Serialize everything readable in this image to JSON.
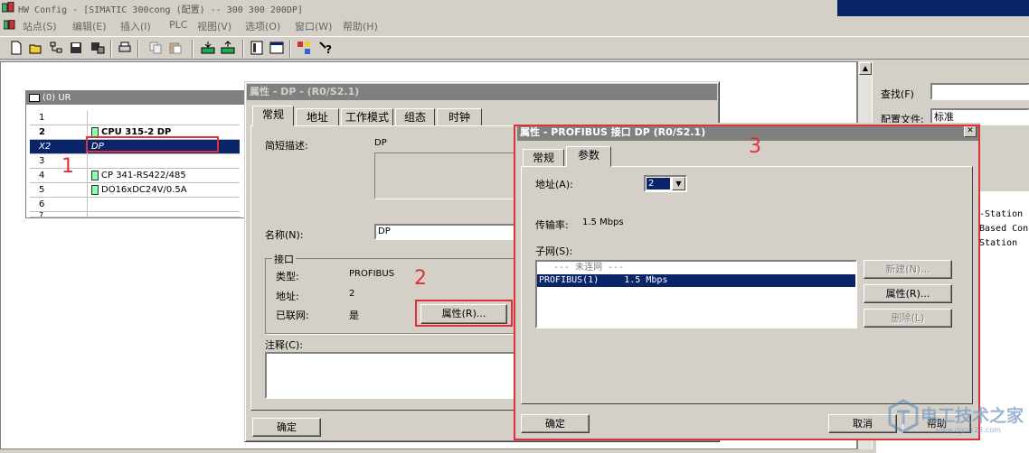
{
  "window": {
    "title": "HW Config - [SIMATIC 300cong (配置) -- 300 300 200DP]"
  },
  "menu": [
    "站点(S)",
    "编辑(E)",
    "插入(I)",
    "PLC",
    "视图(V)",
    "选项(O)",
    "窗口(W)",
    "帮助(H)"
  ],
  "toolbar_icons": [
    "new-icon",
    "open-icon",
    "network-icon",
    "save-icon",
    "save-compile-icon",
    "print-icon",
    "copy-icon",
    "paste-icon",
    "download-icon",
    "upload-icon",
    "hardware-catalog-icon",
    "window-icon",
    "network-view-icon",
    "help-icon"
  ],
  "rack": {
    "title": "(0) UR",
    "rows": [
      {
        "slot": "1",
        "module": ""
      },
      {
        "slot": "2",
        "module": "CPU 315-2 DP"
      },
      {
        "slot": "X2",
        "module": "DP"
      },
      {
        "slot": "3",
        "module": ""
      },
      {
        "slot": "4",
        "module": "CP 341-RS422/485"
      },
      {
        "slot": "5",
        "module": "DO16xDC24V/0.5A"
      },
      {
        "slot": "6",
        "module": ""
      },
      {
        "slot": "7",
        "module": ""
      }
    ]
  },
  "right_panel": {
    "search_label": "查找(F)",
    "search_value": "",
    "profile_label": "配置文件:",
    "profile_value": "标准",
    "list_items": [
      "-Station",
      "Based Cont",
      "Station"
    ]
  },
  "dialog_dp": {
    "title": "属性 - DP - (R0/S2.1)",
    "tabs": [
      "常规",
      "地址",
      "工作模式",
      "组态",
      "时钟"
    ],
    "short_desc_label": "简短描述:",
    "short_desc_value": "DP",
    "name_label": "名称(N):",
    "name_value": "DP",
    "interface_group": "接口",
    "type_label": "类型:",
    "type_value": "PROFIBUS",
    "address_label": "地址:",
    "address_value": "2",
    "networked_label": "已联网:",
    "networked_value": "是",
    "properties_button": "属性(R)...",
    "comment_label": "注释(C):",
    "comment_value": "",
    "ok_button": "确定"
  },
  "dialog_profibus": {
    "title": "属性 - PROFIBUS 接口 DP (R0/S2.1)",
    "tabs": [
      "常规",
      "参数"
    ],
    "address_label": "地址(A):",
    "address_value": "2",
    "rate_label": "传输率:",
    "rate_value": "1.5 Mbps",
    "subnet_label": "子网(S):",
    "subnet_items": [
      {
        "name": "--- 未连网 ---",
        "rate": ""
      },
      {
        "name": "PROFIBUS(1)",
        "rate": "1.5 Mbps"
      }
    ],
    "new_button": "新建(N)...",
    "properties_button": "属性(R)...",
    "delete_button": "删除(L)",
    "ok_button": "确定",
    "cancel_button": "取消",
    "help_button": "帮助"
  },
  "annotations": [
    "1",
    "2",
    "3"
  ],
  "watermark": {
    "text": "电工技术之家",
    "url": "www.dgjs123.com"
  },
  "colors": {
    "selection": "#0a246a",
    "highlight_box": "#e0303a",
    "window_bg": "#d4d0c8"
  }
}
